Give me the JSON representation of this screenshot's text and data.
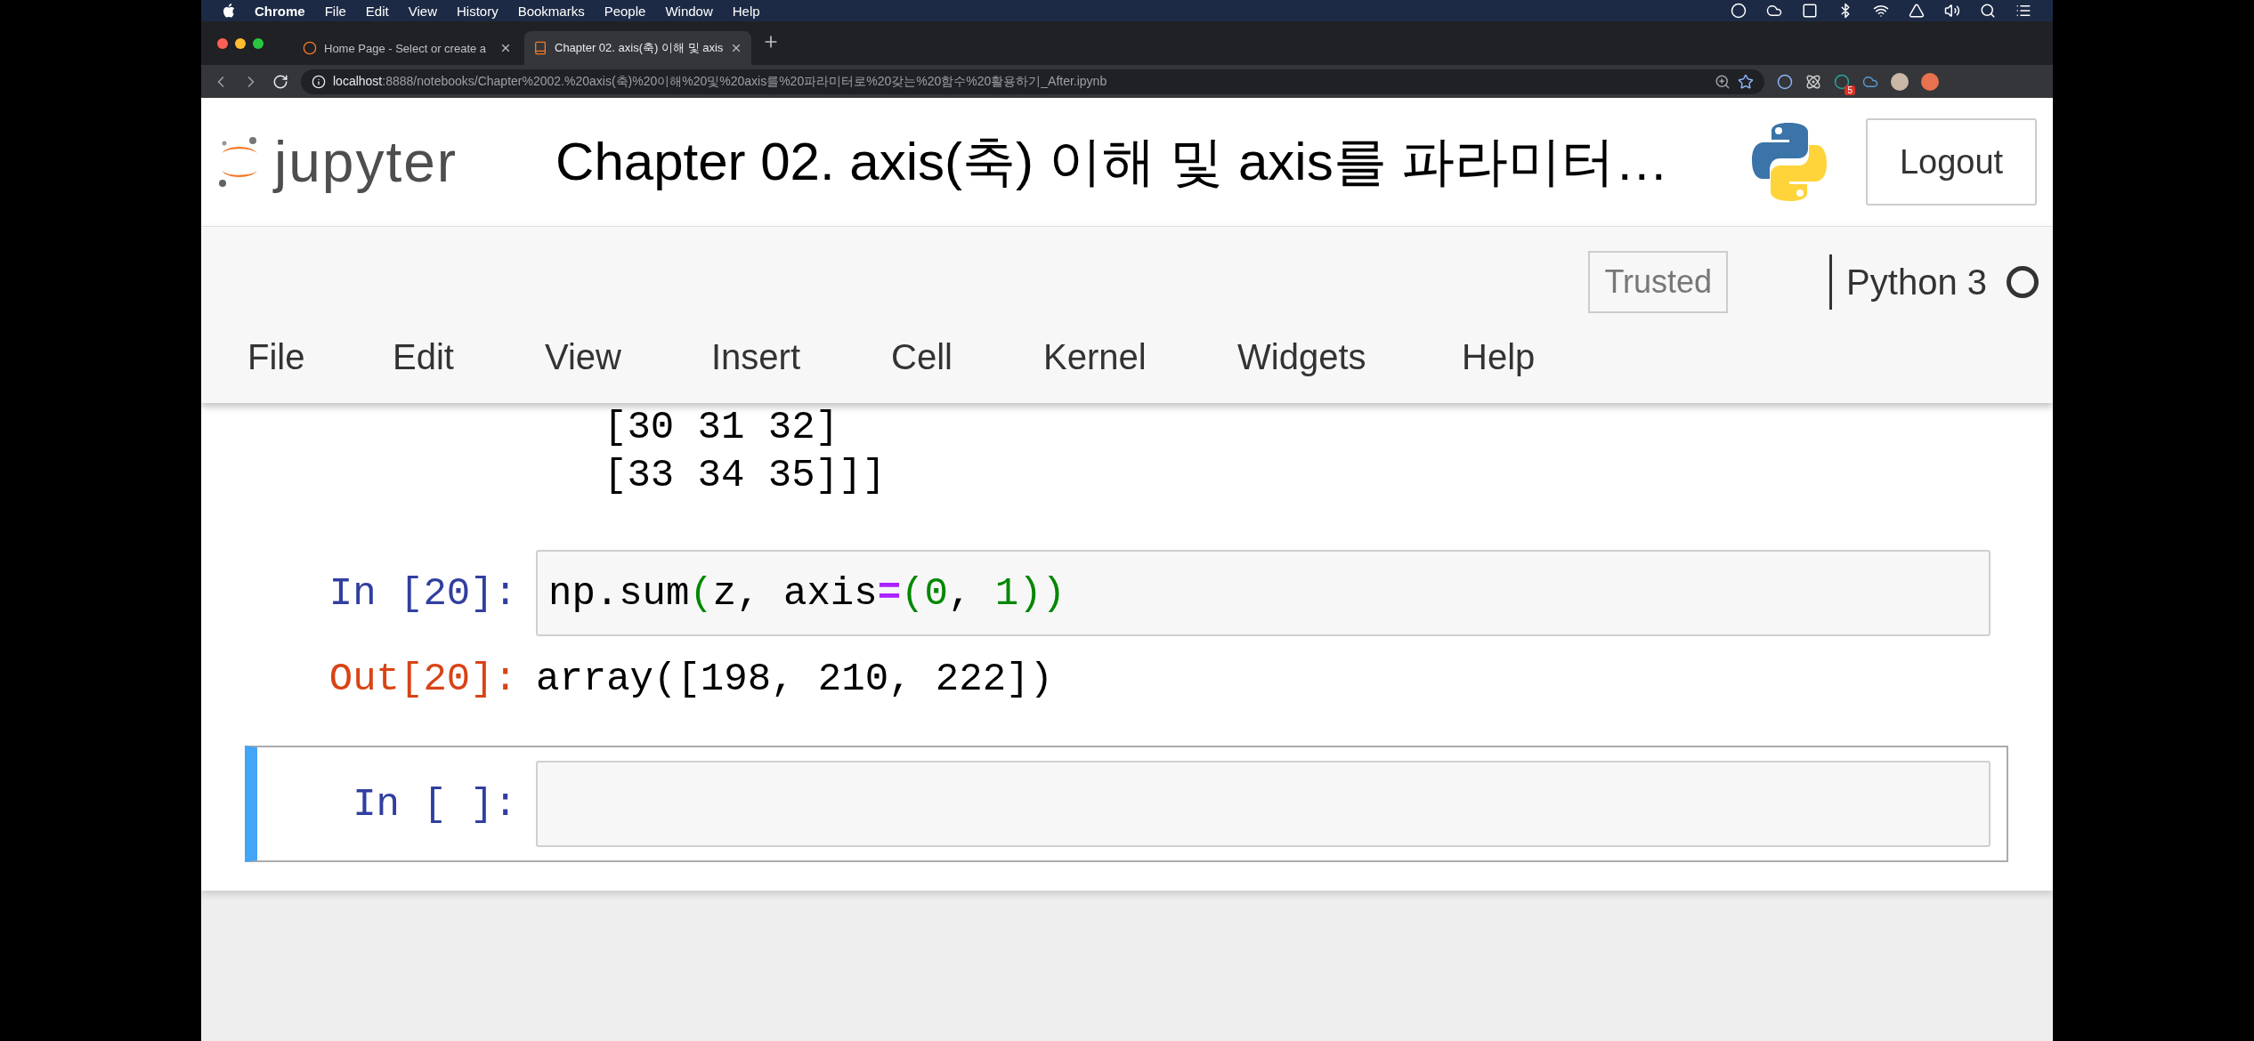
{
  "mac_menu_bar": {
    "app": "Chrome",
    "items": [
      "File",
      "Edit",
      "View",
      "History",
      "Bookmarks",
      "People",
      "Window",
      "Help"
    ]
  },
  "browser": {
    "tabs": [
      {
        "title": "Home Page - Select or create a",
        "selected": false,
        "kind": "jupyter"
      },
      {
        "title": "Chapter 02. axis(축) 이해 및 axis",
        "selected": true,
        "kind": "notebook"
      }
    ],
    "url_host": "localhost",
    "url_rest": ":8888/notebooks/Chapter%2002.%20axis(축)%20이해%20및%20axis를%20파라미터로%20갖는%20함수%20활용하기_After.ipynb",
    "extension_badge": "5"
  },
  "header": {
    "logo_text": "jupyter",
    "notebook_title": "Chapter 02. axis(축) 이해 및 axis를 파라미터…",
    "logout": "Logout"
  },
  "toolbar": {
    "trusted": "Trusted",
    "kernel": "Python 3",
    "kernel_busy": false,
    "menu": [
      "File",
      "Edit",
      "View",
      "Insert",
      "Cell",
      "Kernel",
      "Widgets",
      "Help"
    ]
  },
  "output_lines": [
    "[30 31 32]",
    "[33 34 35]]]"
  ],
  "cells": [
    {
      "selected": false,
      "prompt": "In [20]:",
      "tokens": [
        {
          "text": "np.sum",
          "kind": "plain"
        },
        {
          "text": "(",
          "kind": "paren"
        },
        {
          "text": "z, axis",
          "kind": "plain"
        },
        {
          "text": "=",
          "kind": "op"
        },
        {
          "text": "(",
          "kind": "paren"
        },
        {
          "text": "0",
          "kind": "number"
        },
        {
          "text": ", ",
          "kind": "plain"
        },
        {
          "text": "1",
          "kind": "number"
        },
        {
          "text": "))",
          "kind": "paren"
        }
      ],
      "out_prompt": "Out[20]:",
      "output": "array([198, 210, 222])"
    },
    {
      "selected": true,
      "prompt": "In [ ]:"
    }
  ]
}
